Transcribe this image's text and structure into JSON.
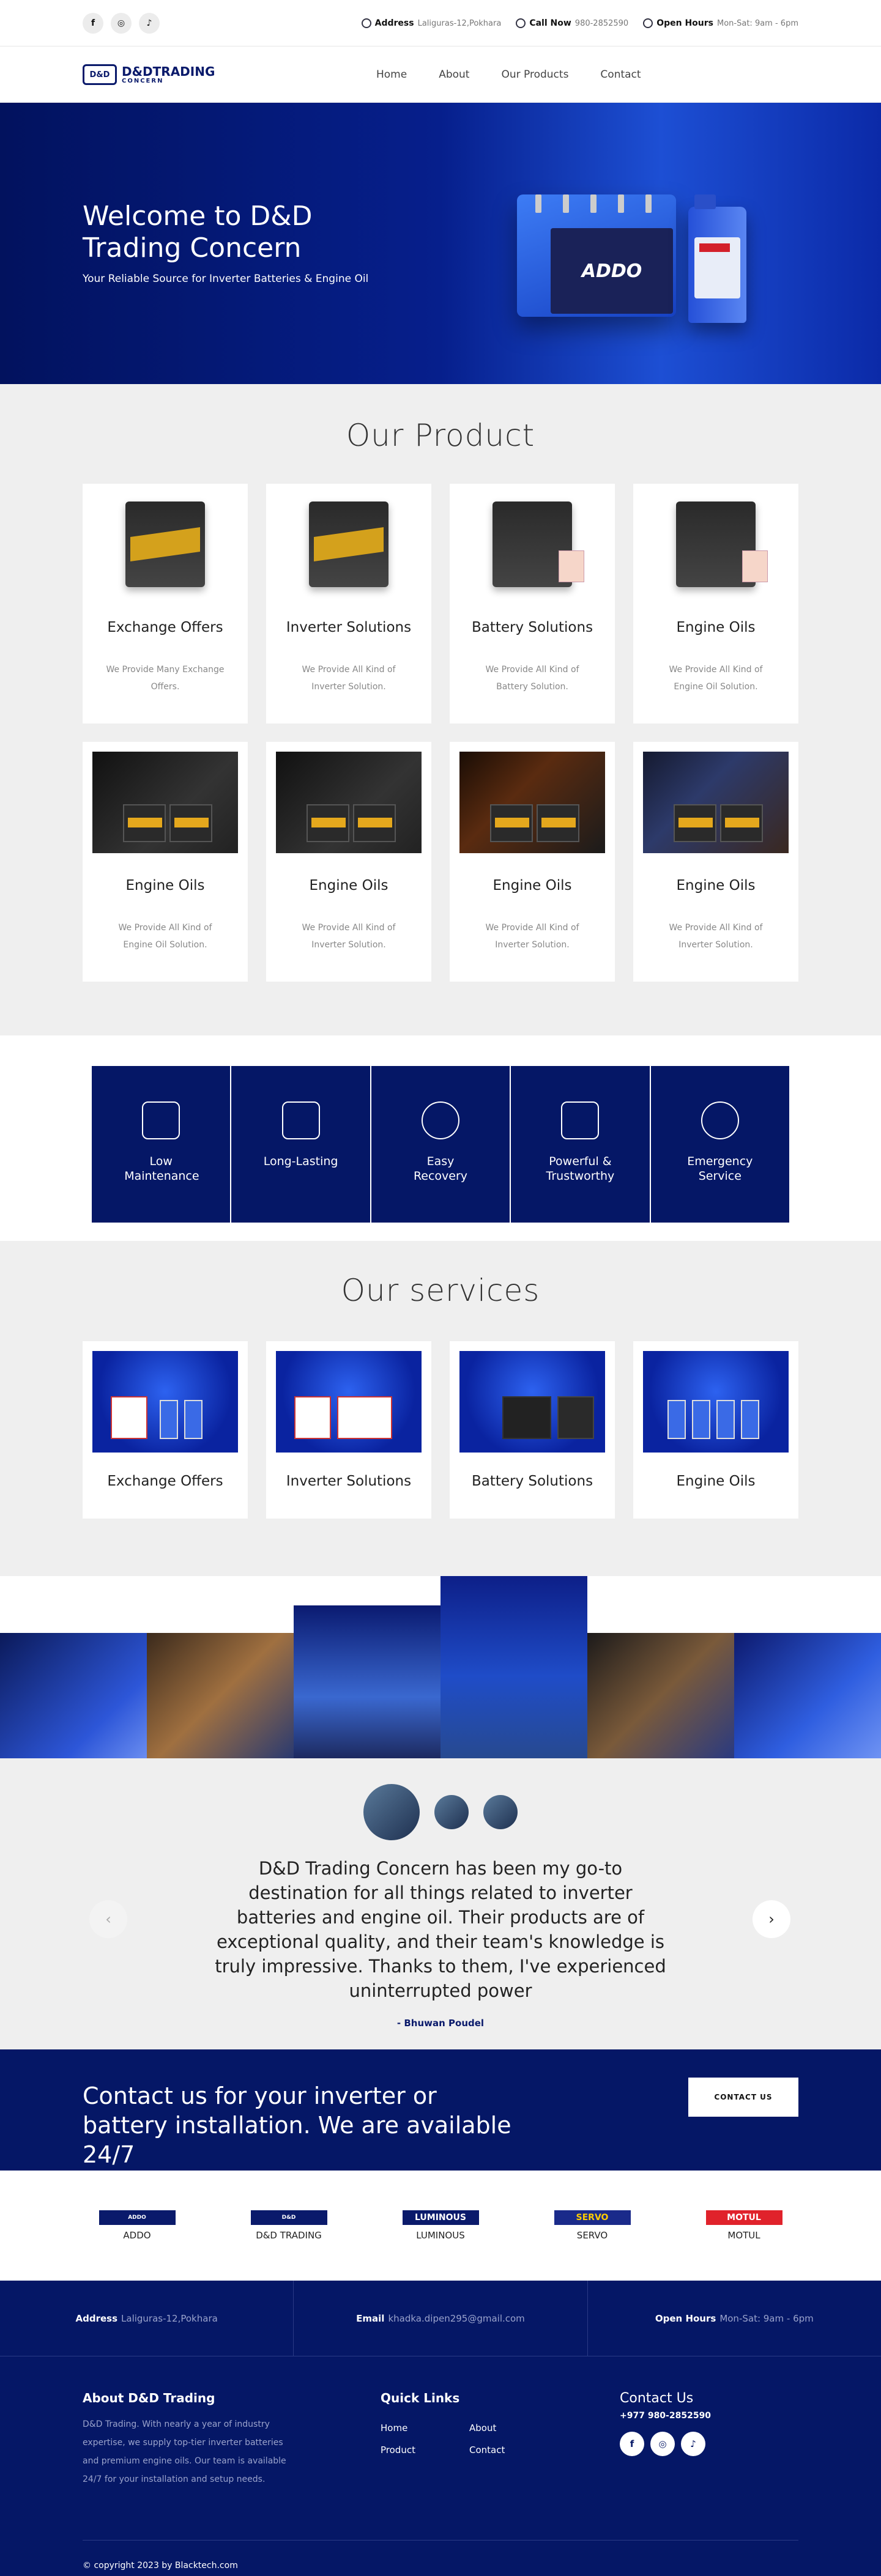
{
  "topbar": {
    "social": [
      "f",
      "◎",
      "♪"
    ],
    "address_label": "Address",
    "address_value": "Laliguras-12,Pokhara",
    "call_label": "Call Now",
    "call_value": "980-2852590",
    "hours_label": "Open Hours",
    "hours_value": "Mon-Sat: 9am - 6pm"
  },
  "nav": {
    "logo_title": "D&DTRADING",
    "logo_sub": "CONCERN",
    "logo_mark": "D&D",
    "items": [
      "Home",
      "About",
      "Our Products",
      "Contact"
    ]
  },
  "hero": {
    "title": "Welcome to D&D Trading Concern",
    "subtitle": "Your Reliable Source for Inverter Batteries & Engine Oil",
    "battery_brand": "ADDO"
  },
  "products": {
    "title": "Our Product",
    "items": [
      {
        "title": "Exchange Offers",
        "desc": "We Provide Many Exchange Offers."
      },
      {
        "title": "Inverter Solutions",
        "desc": "We Provide All Kind of Inverter Solution."
      },
      {
        "title": "Battery Solutions",
        "desc": "We Provide All Kind of Battery Solution."
      },
      {
        "title": "Engine Oils",
        "desc": "We Provide All Kind of Engine Oil Solution."
      },
      {
        "title": "Engine Oils",
        "desc": "We Provide All Kind of Engine Oil Solution."
      },
      {
        "title": "Engine Oils",
        "desc": "We Provide All Kind of Inverter Solution."
      },
      {
        "title": "Engine Oils",
        "desc": "We Provide All Kind of Inverter Solution."
      },
      {
        "title": "Engine Oils",
        "desc": "We Provide All Kind of Inverter Solution."
      }
    ]
  },
  "features": [
    "Low Maintenance",
    "Long-Lasting",
    "Easy Recovery",
    "Powerful & Trustworthy",
    "Emergency Service"
  ],
  "services": {
    "title": "Our services",
    "items": [
      "Exchange Offers",
      "Inverter Solutions",
      "Battery Solutions",
      "Engine Oils"
    ]
  },
  "testimonial": {
    "quote": "D&D Trading Concern has been my go-to destination for all things related to inverter batteries and engine oil. Their products are of exceptional quality, and their team's knowledge is truly impressive. Thanks to them, I've experienced uninterrupted power",
    "author": "- Bhuwan Poudel",
    "prev": "‹",
    "next": "›"
  },
  "cta": {
    "text": "Contact us for your inverter or battery installation. We are available 24/7",
    "button": "CONTACT US"
  },
  "brands": [
    {
      "name": "ADDO",
      "logo": "ADDO",
      "color": "#0a1a6b"
    },
    {
      "name": "D&D TRADING",
      "logo": "D&D",
      "color": "#0a1a6b"
    },
    {
      "name": "LUMINOUS",
      "logo": "LUMINOUS",
      "color": "#0a1a6b"
    },
    {
      "name": "SERVO",
      "logo": "SERVO",
      "color": "#1a2a8a"
    },
    {
      "name": "MOTUL",
      "logo": "MOTUL",
      "color": "#e0222b"
    }
  ],
  "footer_info": {
    "address_label": "Address",
    "address_value": "Laliguras-12,Pokhara",
    "email_label": "Email",
    "email_value": "khadka.dipen295@gmail.com",
    "hours_label": "Open Hours",
    "hours_value": "Mon-Sat: 9am - 6pm"
  },
  "footer": {
    "about_title": "About D&D Trading",
    "about_text": "D&D Trading. With nearly a year of industry expertise, we supply top-tier inverter batteries and premium engine oils. Our team is available 24/7 for your installation and setup needs.",
    "links_title": "Quick Links",
    "links": [
      "Home",
      "About",
      "Product",
      "Contact"
    ],
    "contact_title": "Contact Us",
    "phone": "+977 980-2852590",
    "social": [
      "f",
      "◎",
      "♪"
    ],
    "copyright": "© copyright 2023 by Blacktech.com"
  },
  "colors": {
    "primary": "#051766",
    "accent": "#1d4fd4"
  }
}
